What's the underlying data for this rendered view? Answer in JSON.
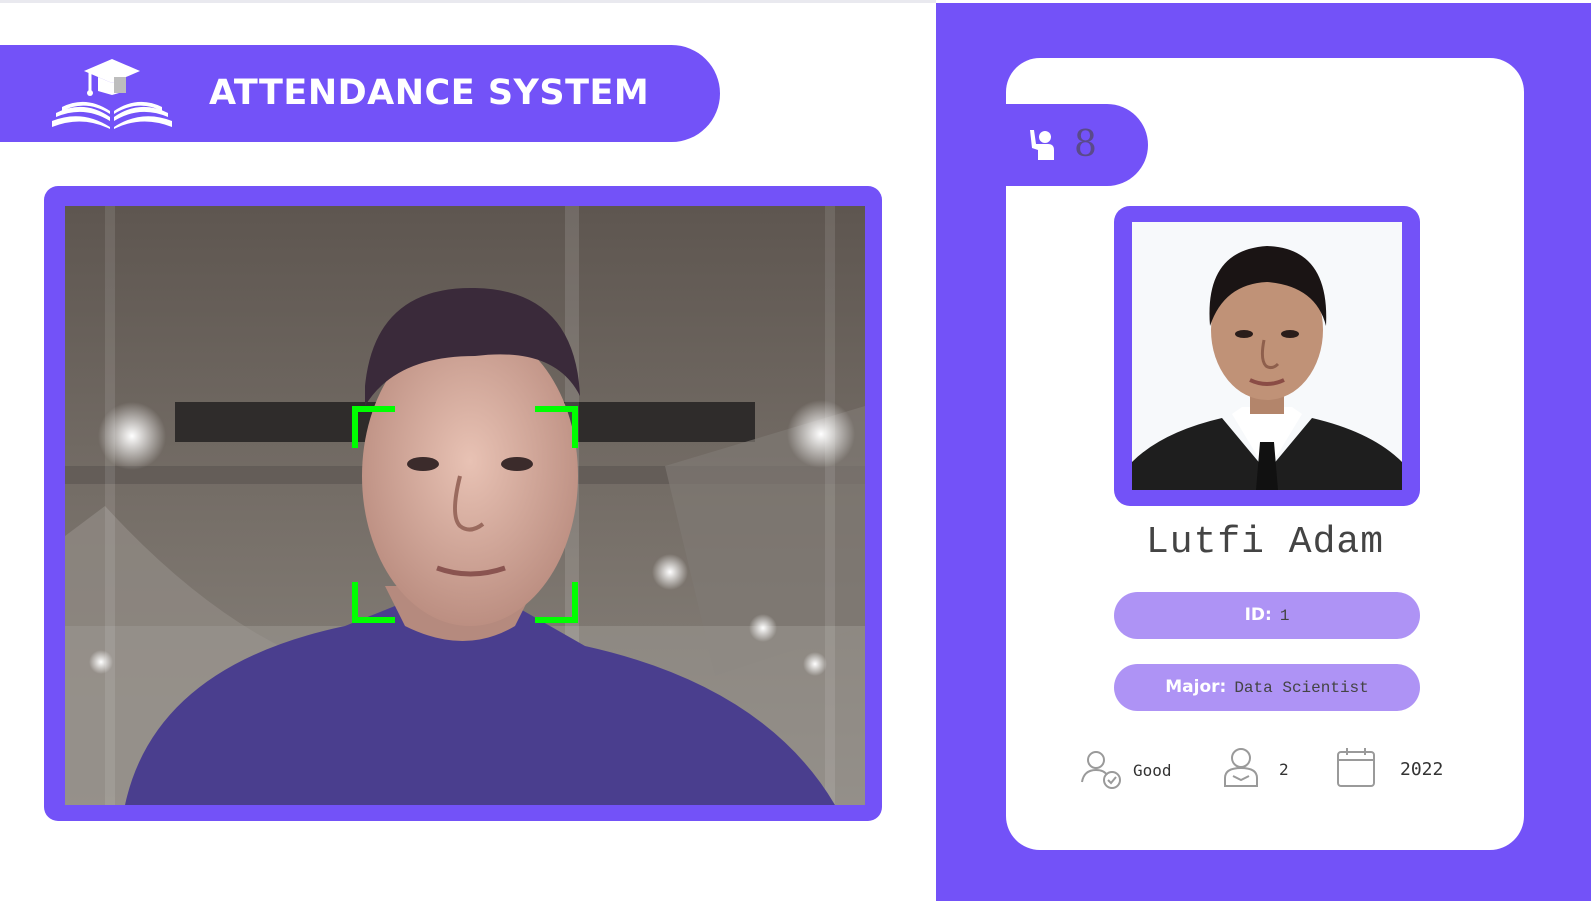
{
  "app": {
    "title": "ATTENDANCE SYSTEM"
  },
  "camera": {
    "face_box_color": "#00ff00"
  },
  "student": {
    "counter": "8",
    "name": "Lutfi Adam",
    "id_label": "ID:",
    "id_value": "1",
    "major_label": "Major:",
    "major_value": "Data Scientist",
    "standing": "Good",
    "year": "2",
    "starting_year": "2022"
  },
  "icons": {
    "logo": "graduation-book-logo",
    "counter": "raised-hand-person-icon",
    "standing": "user-check-icon",
    "year": "user-icon",
    "starting_year": "calendar-icon"
  },
  "colors": {
    "brand": "#7352f8",
    "pill": "#ae93f5",
    "white": "#ffffff"
  }
}
